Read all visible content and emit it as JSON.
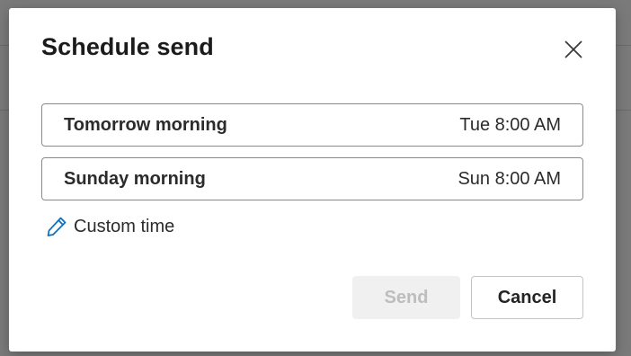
{
  "dialog": {
    "title": "Schedule send",
    "options": [
      {
        "label": "Tomorrow morning",
        "time": "Tue 8:00 AM"
      },
      {
        "label": "Sunday morning",
        "time": "Sun 8:00 AM"
      }
    ],
    "custom_time_label": "Custom time",
    "send_label": "Send",
    "cancel_label": "Cancel",
    "icons": {
      "close": "close-icon",
      "custom_time": "pencil-icon"
    },
    "colors": {
      "pencil_icon": "#0f6cbd",
      "send_disabled_text": "#bdbdbd",
      "send_disabled_bg": "#f0f0f0",
      "backdrop": "#7a7a7a"
    }
  }
}
